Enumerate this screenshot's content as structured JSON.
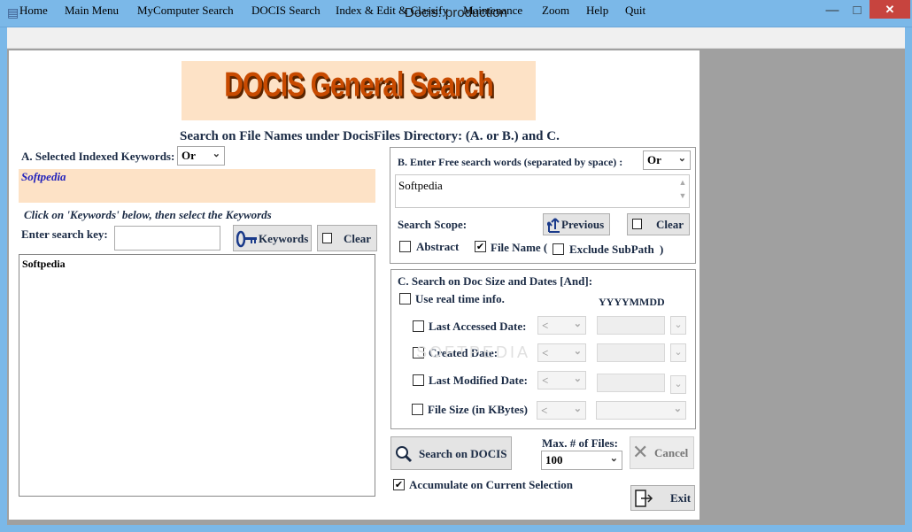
{
  "window": {
    "title": "Docis: production"
  },
  "menu": [
    "Home",
    "Main Menu",
    "MyComputer Search",
    "DOCIS Search",
    "Index & Edit & Classify",
    "Maintenance",
    "Zoom",
    "Help",
    "Quit"
  ],
  "banner": {
    "text": "DOCIS General Search"
  },
  "heading": "Search on File Names under DocisFiles Directory: (A. or B.) and C.",
  "sectionA": {
    "label": "A. Selected Indexed Keywords:",
    "operator": "Or",
    "selected_keyword": "Softpedia",
    "hint": "Click on 'Keywords' below, then select the Keywords",
    "search_key_label": "Enter search key:",
    "search_key_value": "",
    "keywords_button": "Keywords",
    "clear_button": "Clear",
    "list_items": [
      "Softpedia"
    ]
  },
  "sectionB": {
    "label": "B. Enter Free search  words (separated by space) :",
    "operator": "Or",
    "free_text": "Softpedia",
    "scope_label": "Search Scope:",
    "previous_button": "Previous",
    "clear_button": "Clear",
    "abstract_label": "Abstract",
    "abstract_checked": false,
    "filename_label": "File Name (",
    "filename_checked": true,
    "exclude_label": "Exclude SubPath",
    "exclude_checked": false,
    "close_paren": ")"
  },
  "sectionC": {
    "label": "C. Search on Doc Size and Dates [And]:",
    "realtime_label": "Use real time info.",
    "realtime_checked": false,
    "format_label": "YYYYMMDD",
    "rows": [
      {
        "label": "Last Accessed Date:",
        "operator": "<",
        "checked": false
      },
      {
        "label": "Created Date:",
        "operator": "<",
        "checked": false
      },
      {
        "label": "Last Modified Date:",
        "operator": "<",
        "checked": false
      },
      {
        "label": "File Size (in KBytes)",
        "operator": "<",
        "checked": false
      }
    ]
  },
  "actions": {
    "search_button": "Search on DOCIS",
    "max_files_label": "Max. # of Files:",
    "max_files_value": "100",
    "cancel_button": "Cancel",
    "accumulate_label": "Accumulate on Current Selection",
    "accumulate_checked": true,
    "exit_button": "Exit"
  },
  "watermark": "SOFTPEDIA"
}
